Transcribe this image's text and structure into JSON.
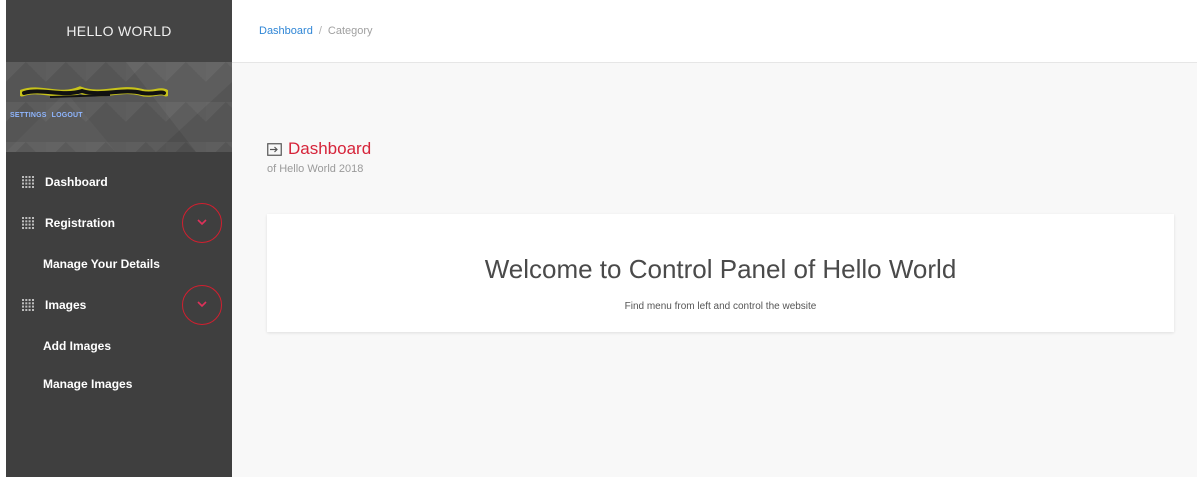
{
  "brand": {
    "title": "HELLO WORLD"
  },
  "profile": {
    "name_redacted": "████████",
    "links": [
      {
        "label": "SETTINGS"
      },
      {
        "label": "LOGOUT"
      }
    ]
  },
  "sidebar": {
    "items": [
      {
        "label": "Dashboard",
        "icon": "grid-icon"
      },
      {
        "label": "Registration",
        "icon": "grid-icon",
        "expandable": true,
        "children": [
          {
            "label": "Manage Your Details"
          }
        ]
      },
      {
        "label": "Images",
        "icon": "grid-icon",
        "expandable": true,
        "children": [
          {
            "label": "Add Images"
          },
          {
            "label": "Manage Images"
          }
        ]
      }
    ]
  },
  "breadcrumb": {
    "link": "Dashboard",
    "separator": "/",
    "current": "Category"
  },
  "page": {
    "title": "Dashboard",
    "subtitle": "of Hello World 2018",
    "icon": "sign-in-icon"
  },
  "card": {
    "heading": "Welcome to Control Panel of Hello World",
    "text": "Find menu from left and control the website"
  },
  "colors": {
    "sidebar_bg": "#3f3f3f",
    "accent_red": "#d6243a",
    "link_blue": "#2f86d6",
    "annotation_red": "#d21f2f"
  }
}
